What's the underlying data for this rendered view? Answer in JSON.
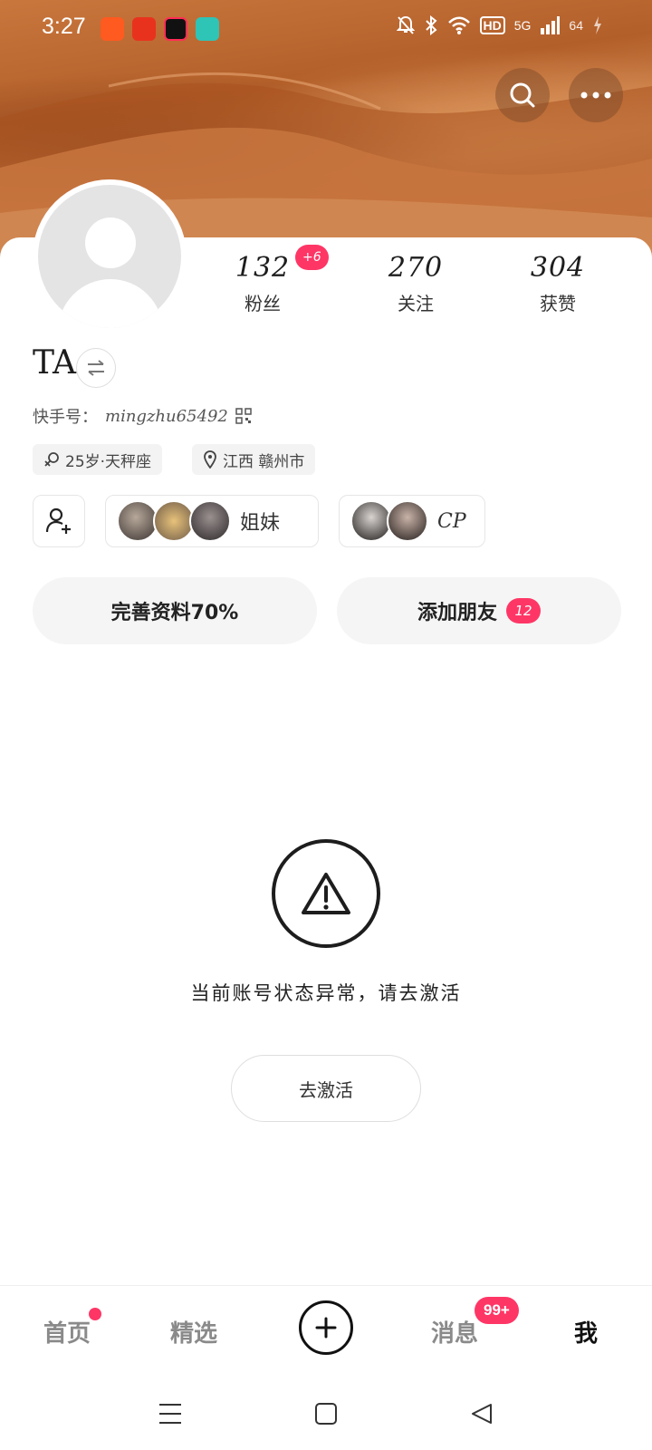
{
  "status_bar": {
    "time": "3:27",
    "network": "5G",
    "hd_label": "HD",
    "battery": "64",
    "icons": [
      "app-kuaishou-icon",
      "app-ting-icon",
      "app-video-icon",
      "app-chat-icon",
      "mute-bell-icon",
      "bluetooth-icon",
      "wifi-icon",
      "signal-icon",
      "battery-charging-icon"
    ]
  },
  "header": {
    "search_icon": "search-icon",
    "more_icon": "more-icon"
  },
  "profile": {
    "stats": [
      {
        "value": "132",
        "label": "粉丝",
        "badge": "+6"
      },
      {
        "value": "270",
        "label": "关注"
      },
      {
        "value": "304",
        "label": "获赞"
      }
    ],
    "name": "TA",
    "id_prefix": "快手号：",
    "id_value": "mingzhu65492",
    "tags": [
      {
        "icon": "female-icon",
        "text": "25岁·天秤座"
      },
      {
        "icon": "location-pin-icon",
        "text": "江西 赣州市"
      }
    ],
    "groups": [
      {
        "label": "姐妹"
      },
      {
        "label": "CP"
      }
    ],
    "actions": {
      "complete_profile": "完善资料70%",
      "add_friends": "添加朋友",
      "add_friends_count": "12"
    }
  },
  "warning": {
    "message": "当前账号状态异常，请去激活",
    "button": "去激活"
  },
  "bottom_nav": {
    "home": "首页",
    "featured": "精选",
    "messages": "消息",
    "messages_badge": "99+",
    "me": "我"
  },
  "colors": {
    "accent": "#fe3666",
    "banner": "#b8632c"
  }
}
